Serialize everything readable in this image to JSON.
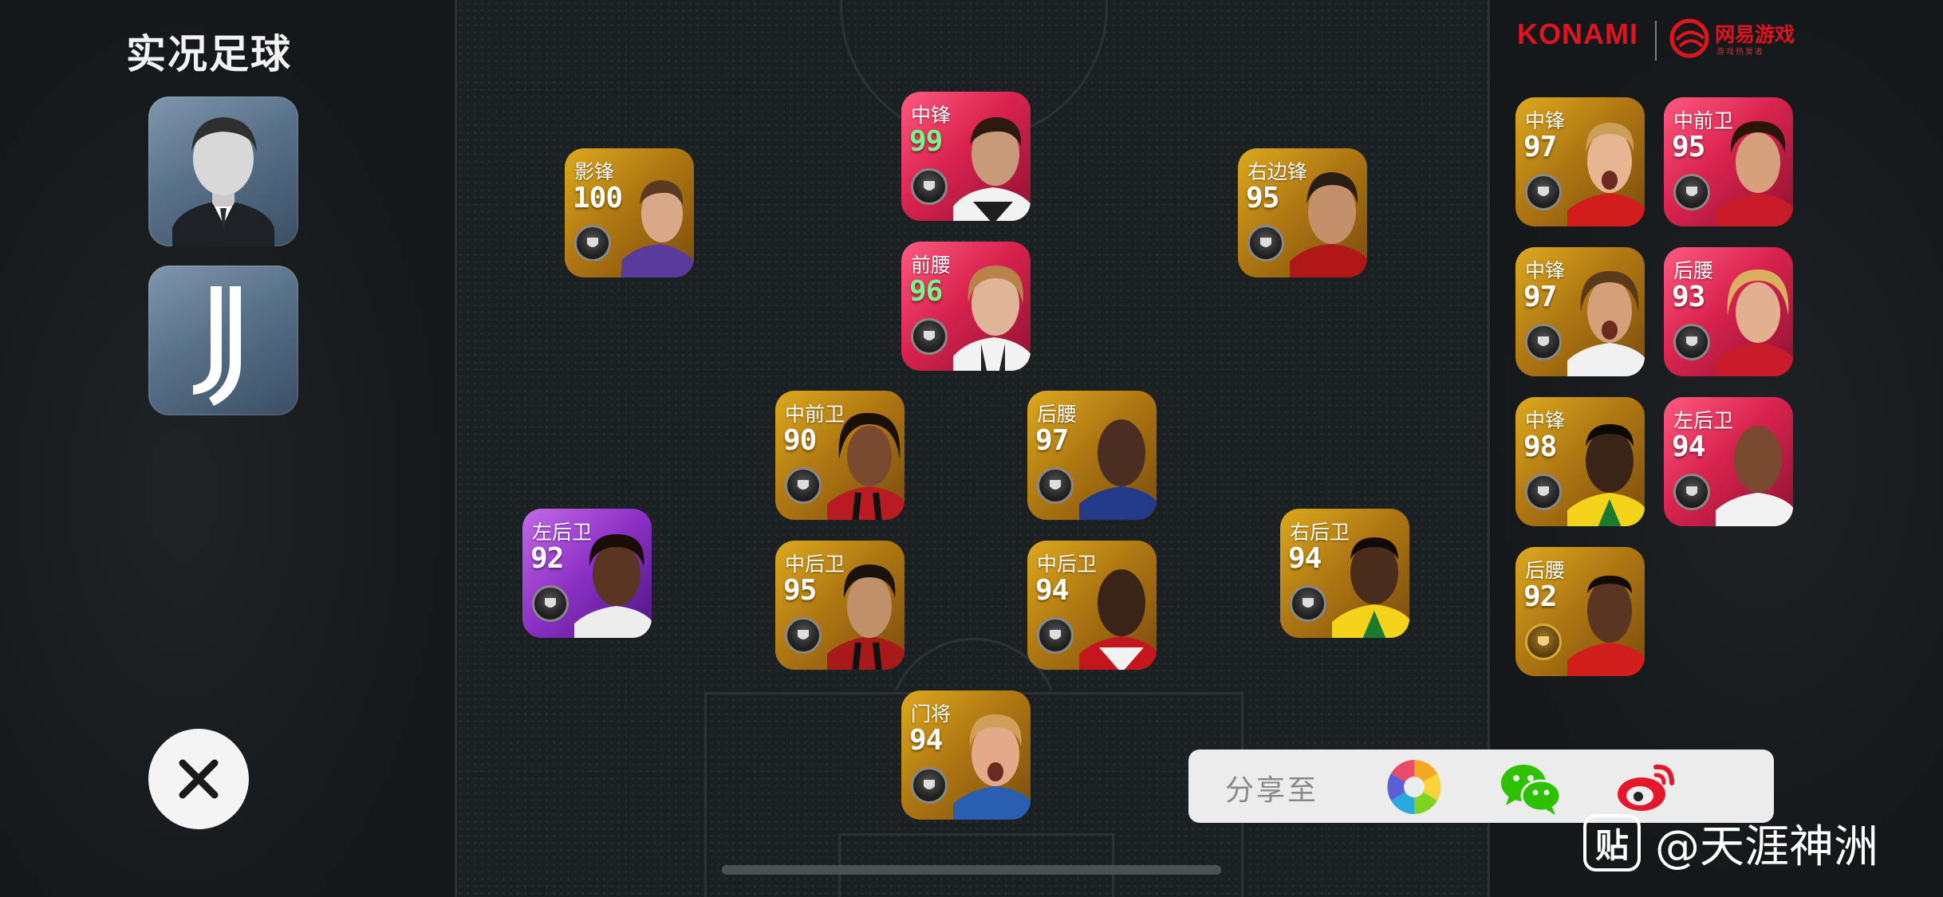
{
  "app": {
    "title": "实况足球"
  },
  "logos": {
    "konami": "KONAMI",
    "netease": "网易游戏",
    "netease_sub": "游戏热爱者"
  },
  "formation": [
    {
      "id": "cf-ronaldo",
      "position": "中锋",
      "rating": "99",
      "tier": "pink",
      "rating_color": "green"
    },
    {
      "id": "ss-cruyff",
      "position": "影锋",
      "rating": "100",
      "tier": "gold"
    },
    {
      "id": "rw-figo",
      "position": "右边锋",
      "rating": "95",
      "tier": "gold"
    },
    {
      "id": "am-nedved",
      "position": "前腰",
      "rating": "96",
      "tier": "pink",
      "rating_color": "green"
    },
    {
      "id": "cm-gullit",
      "position": "中前卫",
      "rating": "90",
      "tier": "gold"
    },
    {
      "id": "dm-vieira",
      "position": "后腰",
      "rating": "97",
      "tier": "gold"
    },
    {
      "id": "lb-player",
      "position": "左后卫",
      "rating": "92",
      "tier": "purple"
    },
    {
      "id": "cb-maldini",
      "position": "中后卫",
      "rating": "95",
      "tier": "gold"
    },
    {
      "id": "cb-campbell",
      "position": "中后卫",
      "rating": "94",
      "tier": "gold"
    },
    {
      "id": "rb-cafu",
      "position": "右后卫",
      "rating": "94",
      "tier": "gold"
    },
    {
      "id": "gk-kahn",
      "position": "门将",
      "rating": "94",
      "tier": "gold"
    }
  ],
  "bench": [
    {
      "position": "中锋",
      "rating": "97",
      "tier": "gold"
    },
    {
      "position": "中前卫",
      "rating": "95",
      "tier": "pink"
    },
    {
      "position": "中锋",
      "rating": "97",
      "tier": "gold"
    },
    {
      "position": "后腰",
      "rating": "93",
      "tier": "pink"
    },
    {
      "position": "中锋",
      "rating": "98",
      "tier": "gold"
    },
    {
      "position": "左后卫",
      "rating": "94",
      "tier": "pink"
    },
    {
      "position": "后腰",
      "rating": "92",
      "tier": "gold",
      "badge": "gold"
    }
  ],
  "share": {
    "label": "分享至",
    "targets": [
      "photos-icon",
      "wechat-icon",
      "weibo-icon"
    ]
  },
  "watermark": {
    "platform_glyph": "贴",
    "text": "@天涯神洲"
  }
}
